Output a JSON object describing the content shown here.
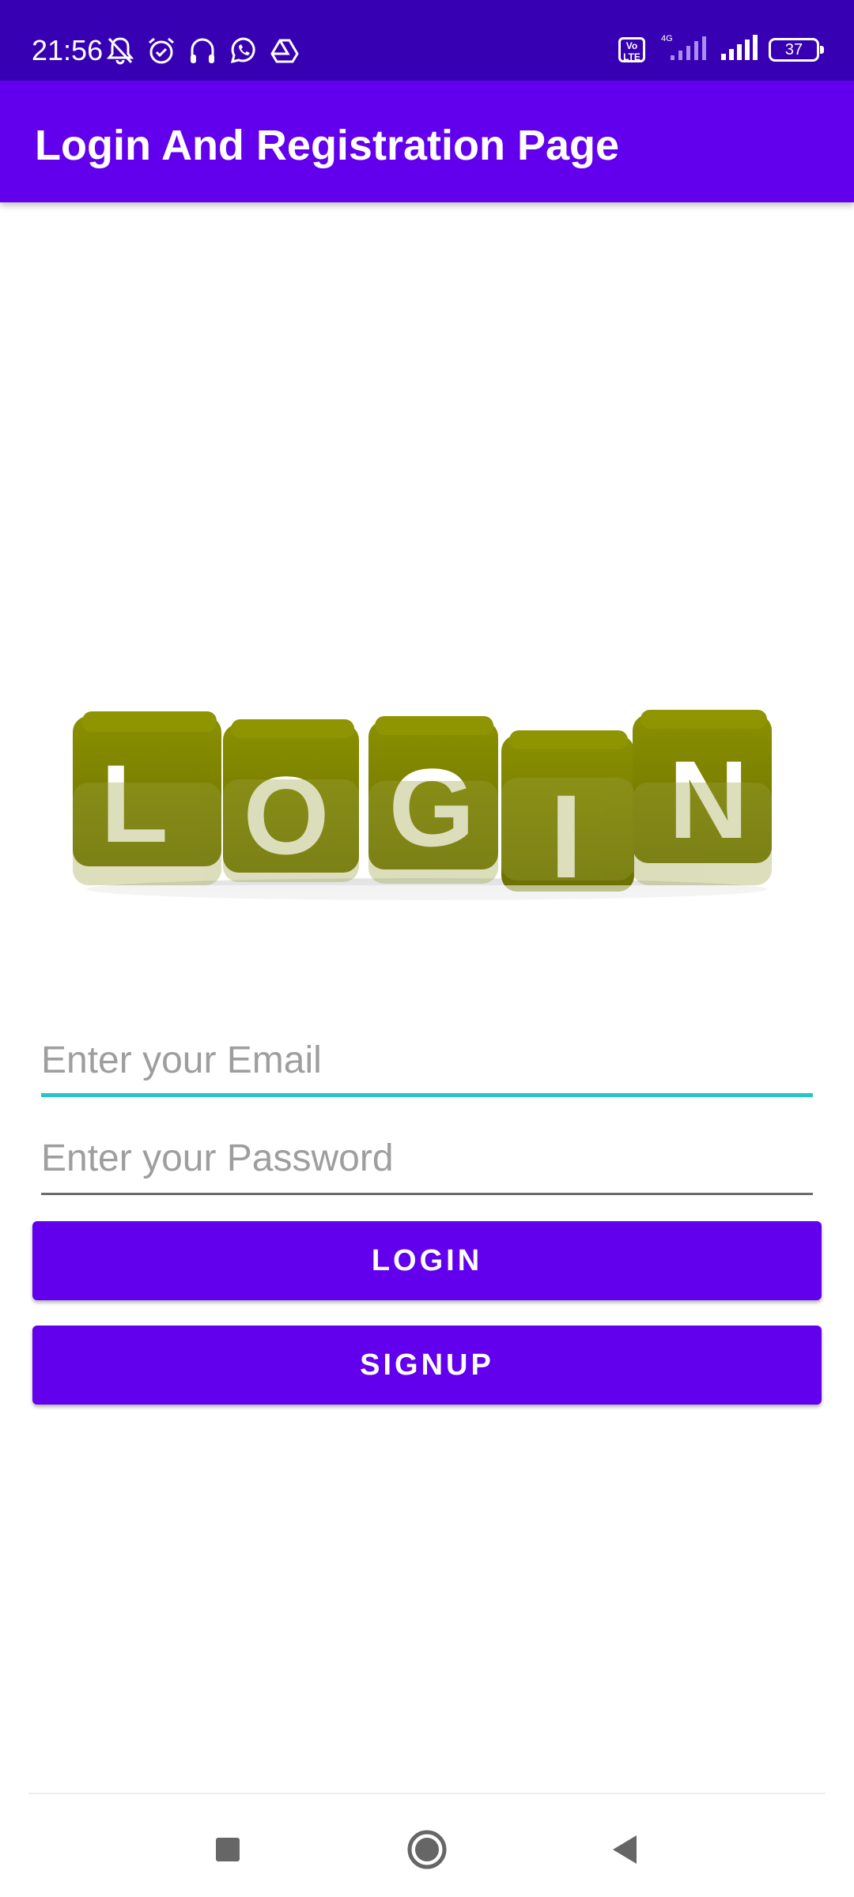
{
  "status_bar": {
    "time": "21:56",
    "icons_left": [
      "bell-off-icon",
      "alarm-icon",
      "headphones-icon",
      "whatsapp-icon",
      "drive-icon"
    ],
    "volte_label": "Vo\nLTE",
    "network_label": "4G",
    "battery_level": "37"
  },
  "app_bar": {
    "title": "Login And Registration Page"
  },
  "hero": {
    "letters": [
      "L",
      "O",
      "G",
      "I",
      "N"
    ],
    "cube_color": "#7a8000"
  },
  "form": {
    "email_placeholder": "Enter your Email",
    "password_placeholder": "Enter your Password",
    "email_value": "",
    "password_value": ""
  },
  "buttons": {
    "login_label": "LOGIN",
    "signup_label": "SIGNUP"
  },
  "colors": {
    "status_bar": "#3700b3",
    "primary": "#6200ee",
    "accent_underline": "#26c6c6"
  },
  "nav": {
    "items": [
      "recents-icon",
      "home-icon",
      "back-icon"
    ]
  }
}
